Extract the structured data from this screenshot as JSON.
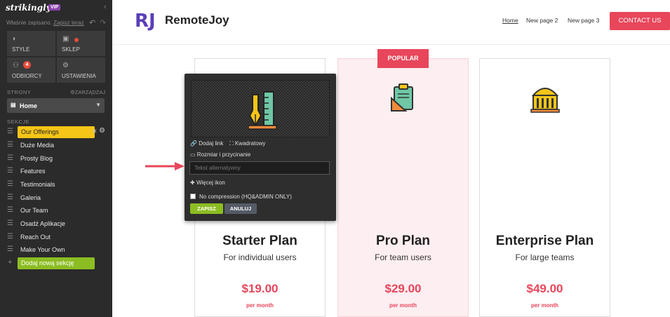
{
  "sidebar": {
    "logo": "strikingly",
    "vip": "VIP",
    "saved_text": "Właśnie zapisano.",
    "save_now_link": "Zapisz teraz",
    "tiles": [
      {
        "label": "STYLE",
        "icon": "palette-icon"
      },
      {
        "label": "SKLEP",
        "icon": "shop-bag-icon"
      },
      {
        "label": "ODBIORCY",
        "icon": "users-icon",
        "badge": "4"
      },
      {
        "label": "USTAWIENIA",
        "icon": "gear-icon"
      }
    ],
    "pages_heading": "STRONY",
    "manage_label": "ZARZĄDZAJ",
    "current_page": "Home",
    "sections_heading": "SEKCJE",
    "sections": [
      "Our Offerings",
      "Duże Media",
      "Prosty Blog",
      "Features",
      "Testimonials",
      "Galeria",
      "Our Team",
      "Osadź Aplikacje",
      "Reach Out",
      "Make Your Own"
    ],
    "add_section": "Dodaj nową sekcję"
  },
  "header": {
    "brand_mark": "RJ",
    "brand_name": "RemoteJoy",
    "nav": [
      "Home",
      "New page 2",
      "New page 3"
    ],
    "cta": "CONTACT US"
  },
  "pricing": {
    "popular_badge": "POPULAR",
    "plans": [
      {
        "title": "Starter Plan",
        "subtitle": "For individual users",
        "price": "$19.00",
        "period": "per month"
      },
      {
        "title": "Pro Plan",
        "subtitle": "For team users",
        "price": "$29.00",
        "period": "per month"
      },
      {
        "title": "Enterprise Plan",
        "subtitle": "For large teams",
        "price": "$49.00",
        "period": "per month"
      }
    ]
  },
  "image_editor": {
    "add_link": "Dodaj link",
    "square": "Kwadratowy",
    "resize": "Rozmiar i przycinanie",
    "alt_placeholder": "Tekst alternatywny",
    "more_icons": "Więcej ikon",
    "no_compression": "No compression (HQ&ADMIN ONLY)",
    "save": "ZAPISZ",
    "cancel": "ANULUJ"
  },
  "colors": {
    "accent_red": "#e8465b",
    "accent_green": "#8cbd23",
    "accent_yellow": "#f5c518",
    "brand_purple": "#5b3fb8"
  }
}
